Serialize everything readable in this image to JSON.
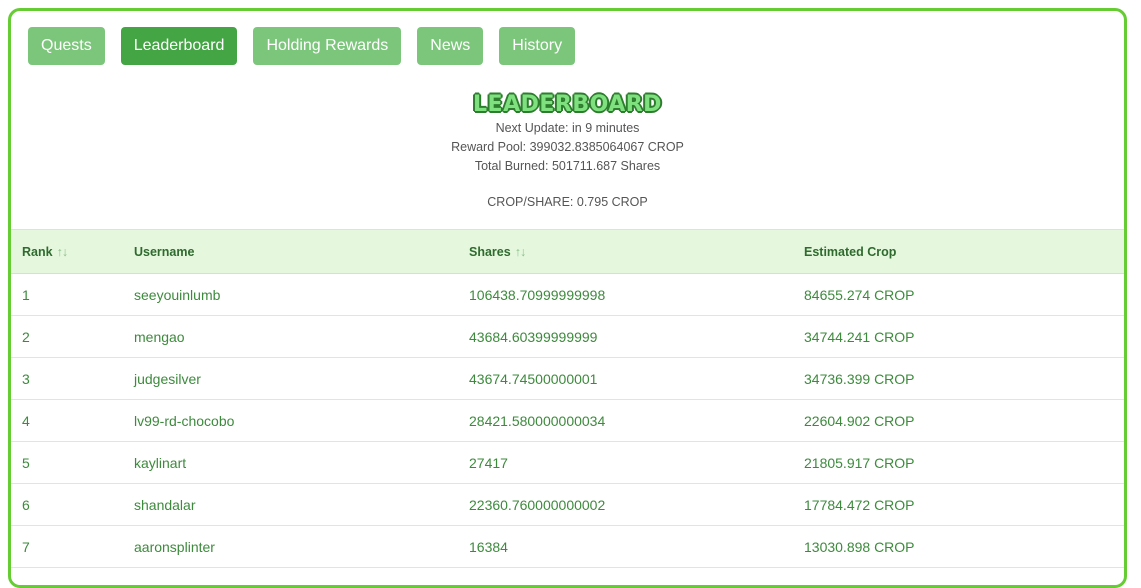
{
  "tabs": [
    {
      "label": "Quests",
      "active": false
    },
    {
      "label": "Leaderboard",
      "active": true
    },
    {
      "label": "Holding Rewards",
      "active": false
    },
    {
      "label": "News",
      "active": false
    },
    {
      "label": "History",
      "active": false
    }
  ],
  "header": {
    "title": "LEADERBOARD",
    "next_update": "Next Update: in 9 minutes",
    "reward_pool": "Reward Pool: 399032.8385064067 CROP",
    "total_burned": "Total Burned: 501711.687 Shares",
    "crop_per_share": "CROP/SHARE: 0.795 CROP"
  },
  "table": {
    "columns": [
      "Rank",
      "Username",
      "Shares",
      "Estimated Crop"
    ],
    "sort_icon": "↑↓",
    "rows": [
      {
        "rank": "1",
        "username": "seeyouinlumb",
        "shares": "106438.70999999998",
        "crop": "84655.274 CROP"
      },
      {
        "rank": "2",
        "username": "mengao",
        "shares": "43684.60399999999",
        "crop": "34744.241 CROP"
      },
      {
        "rank": "3",
        "username": "judgesilver",
        "shares": "43674.74500000001",
        "crop": "34736.399 CROP"
      },
      {
        "rank": "4",
        "username": "lv99-rd-chocobo",
        "shares": "28421.580000000034",
        "crop": "22604.902 CROP"
      },
      {
        "rank": "5",
        "username": "kaylinart",
        "shares": "27417",
        "crop": "21805.917 CROP"
      },
      {
        "rank": "6",
        "username": "shandalar",
        "shares": "22360.760000000002",
        "crop": "17784.472 CROP"
      },
      {
        "rank": "7",
        "username": "aaronsplinter",
        "shares": "16384",
        "crop": "13030.898 CROP"
      }
    ]
  },
  "colors": {
    "accent": "#66cc33",
    "tab": "#7cc67c",
    "tab_active": "#43a543",
    "header_bg": "#e5f8dd",
    "text_green": "#3d8a3d"
  }
}
